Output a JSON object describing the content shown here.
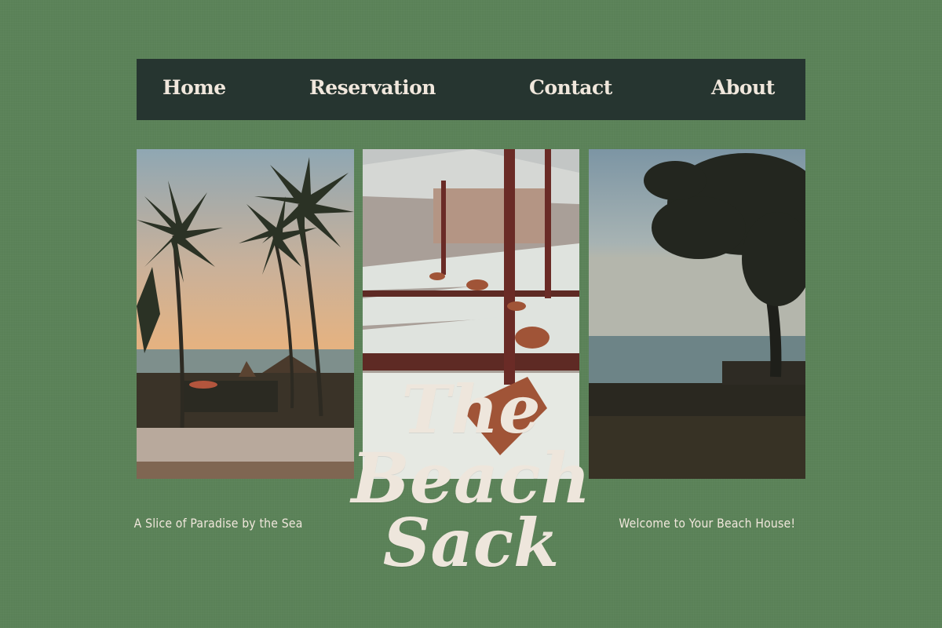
{
  "nav": {
    "items": [
      {
        "label": "Home"
      },
      {
        "label": "Reservation"
      },
      {
        "label": "Contact"
      },
      {
        "label": "About"
      }
    ]
  },
  "photos": [
    {
      "subject": "palm-trees-sunset"
    },
    {
      "subject": "beach-loungers-towels"
    },
    {
      "subject": "tree-silhouette-sea"
    }
  ],
  "brand": {
    "line1": "The",
    "line2": "Beach",
    "line3": "Sack"
  },
  "taglines": {
    "left": "A Slice of Paradise by the Sea",
    "right": "Welcome to Your Beach House!"
  },
  "colors": {
    "background": "#5a8157",
    "nav_bg": "#263530",
    "text": "#f0e7dc"
  }
}
